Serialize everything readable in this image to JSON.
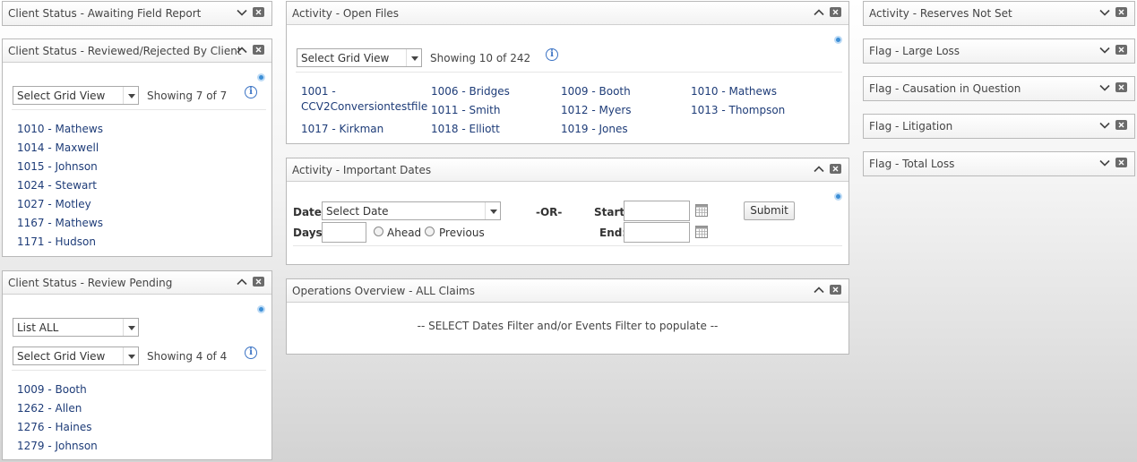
{
  "left": {
    "awaiting": {
      "title": "Client Status - Awaiting Field Report"
    },
    "reviewed": {
      "title": "Client Status - Reviewed/Rejected By Client",
      "grid_view": "Select Grid View",
      "showing": "Showing  7 of 7",
      "items": [
        "1010 - Mathews",
        "1014 - Maxwell",
        "1015 - Johnson",
        "1024 - Stewart",
        "1027 - Motley",
        "1167 - Mathews",
        "1171 - Hudson"
      ]
    },
    "pending": {
      "title": "Client Status - Review Pending",
      "list_filter": "List ALL",
      "grid_view": "Select Grid View",
      "showing": "Showing  4 of 4",
      "items": [
        "1009 - Booth",
        "1262 - Allen",
        "1276 - Haines",
        "1279 - Johnson"
      ]
    }
  },
  "middle": {
    "open_files": {
      "title": "Activity - Open Files",
      "grid_view": "Select Grid View",
      "showing": "Showing  10 of 242",
      "files": [
        "1001 -",
        "CCV2Conversiontestfile",
        "1006 - Bridges",
        "1009 - Booth",
        "1010 - Mathews",
        "1011 - Smith",
        "1012 - Myers",
        "1013 - Thompson",
        "1017 - Kirkman",
        "1018 - Elliott",
        "1019 - Jones"
      ]
    },
    "dates": {
      "title": "Activity - Important Dates",
      "date_label": "Date:",
      "date_select": "Select Date",
      "or_label": "-OR-",
      "start_label": "Start:",
      "end_label": "End:",
      "submit": "Submit",
      "days_label": "Days:",
      "ahead": "Ahead",
      "previous": "Previous"
    },
    "ops": {
      "title": "Operations Overview - ALL Claims",
      "message": "-- SELECT Dates Filter and/or Events Filter to populate --"
    }
  },
  "right": {
    "panels": [
      "Activity - Reserves Not Set",
      "Flag - Large Loss",
      "Flag - Causation in Question",
      "Flag - Litigation",
      "Flag - Total Loss"
    ]
  },
  "icons": {
    "expand": "chevron-down-icon",
    "collapse": "chevron-up-icon",
    "close": "close-icon",
    "refresh": "refresh-icon",
    "info": "info-icon",
    "calendar": "calendar-icon"
  },
  "colors": {
    "link": "#1e3c78",
    "info": "#3b73c4",
    "refresh": "#3d8fd6"
  }
}
